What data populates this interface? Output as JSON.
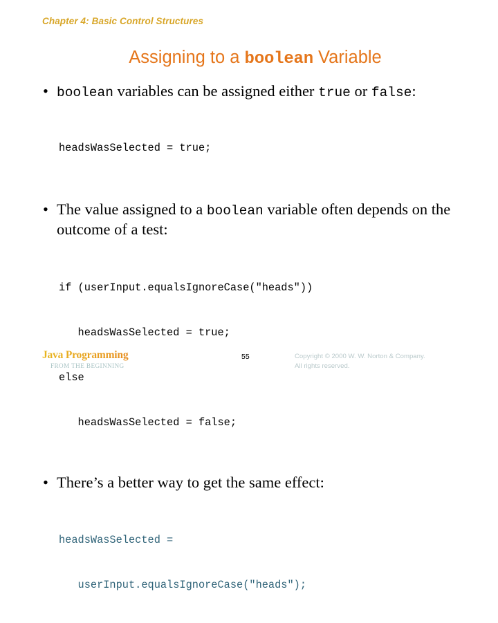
{
  "slide": {
    "chapter_header": "Chapter 4: Basic Control Structures",
    "title_prefix": "Assigning to a ",
    "title_mono": "boolean",
    "title_suffix": " Variable",
    "title_color": "#e5761b",
    "header_color": "#d8a628",
    "background_color": "#ffffff"
  },
  "bullets": [
    {
      "mono1": "boolean",
      "text1": " variables can be assigned either ",
      "mono2": "true",
      "text2": " or ",
      "mono3": "false",
      "text3": ":",
      "marker": "•"
    },
    {
      "text1": "The value assigned to a ",
      "mono1": "boolean",
      "text2": " variable often depends on the outcome of a test:",
      "marker": "•"
    },
    {
      "text1": "There’s a better way to get the same effect:",
      "marker": "•"
    }
  ],
  "code_blocks": [
    {
      "color": "#000000",
      "lines": [
        "headsWasSelected = true;"
      ]
    },
    {
      "color": "#000000",
      "lines": [
        "if (userInput.equalsIgnoreCase(\"heads\"))",
        "   headsWasSelected = true;",
        "else",
        "   headsWasSelected = false;"
      ]
    },
    {
      "color": "#2f6378",
      "lines": [
        "headsWasSelected =",
        "   userInput.equalsIgnoreCase(\"heads\");"
      ]
    }
  ],
  "footer": {
    "brand_title": "Java Programming",
    "brand_subtitle": "FROM THE BEGINNING",
    "page_number": "55",
    "copyright_line1": "Copyright © 2000 W. W. Norton & Company.",
    "copyright_line2": "All rights reserved."
  }
}
